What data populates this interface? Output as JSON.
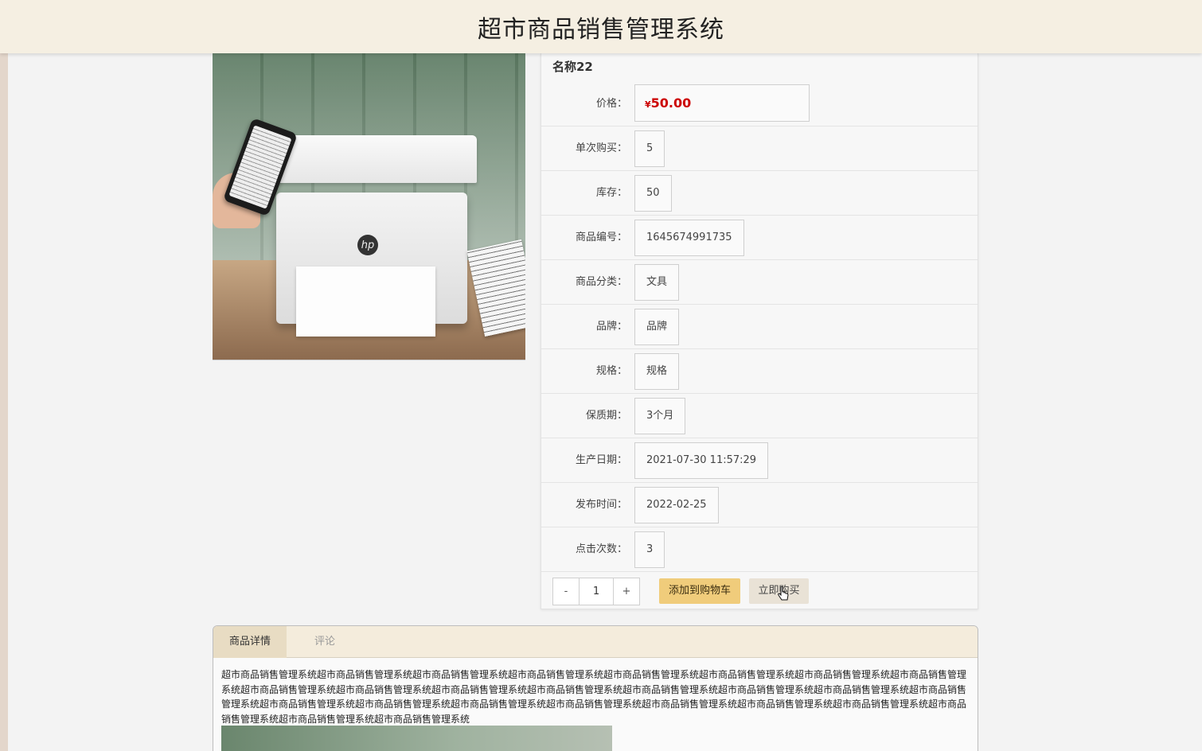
{
  "app": {
    "title": "超市商品销售管理系统"
  },
  "product": {
    "name": "名称22",
    "currency_symbol": "¥",
    "price": "50.00",
    "fields": [
      {
        "label": "价格：",
        "value": "50.00"
      },
      {
        "label": "单次购买：",
        "value": "5"
      },
      {
        "label": "库存：",
        "value": "50"
      },
      {
        "label": "商品编号：",
        "value": "1645674991735"
      },
      {
        "label": "商品分类：",
        "value": "文具"
      },
      {
        "label": "品牌：",
        "value": "品牌"
      },
      {
        "label": "规格：",
        "value": "规格"
      },
      {
        "label": "保质期：",
        "value": "3个月"
      },
      {
        "label": "生产日期：",
        "value": "2021-07-30 11:57:29"
      },
      {
        "label": "发布时间：",
        "value": "2022-02-25"
      },
      {
        "label": "点击次数：",
        "value": "3"
      }
    ]
  },
  "purchase": {
    "minus_label": "-",
    "quantity": "1",
    "plus_label": "+",
    "add_to_cart_label": "添加到购物车",
    "buy_now_label": "立即购买"
  },
  "tabs": {
    "detail_label": "商品详情",
    "comment_label": "评论",
    "detail_text": "超市商品销售管理系统超市商品销售管理系统超市商品销售管理系统超市商品销售管理系统超市商品销售管理系统超市商品销售管理系统超市商品销售管理系统超市商品销售管理系统超市商品销售管理系统超市商品销售管理系统超市商品销售管理系统超市商品销售管理系统超市商品销售管理系统超市商品销售管理系统超市商品销售管理系统超市商品销售管理系统超市商品销售管理系统超市商品销售管理系统超市商品销售管理系统超市商品销售管理系统超市商品销售管理系统超市商品销售管理系统超市商品销售管理系统超市商品销售管理系统超市商品销售管理系统超市商品销售管理系统"
  },
  "colors": {
    "header_bg": "#f5efe2",
    "price_red": "#cc0000",
    "add_cart_bg": "#f0cc7b",
    "buy_now_bg": "#e9e2d6",
    "tab_active_bg": "#e8dcc3"
  },
  "icons": {
    "cursor": "pointer-hand-icon",
    "logo": "hp"
  }
}
